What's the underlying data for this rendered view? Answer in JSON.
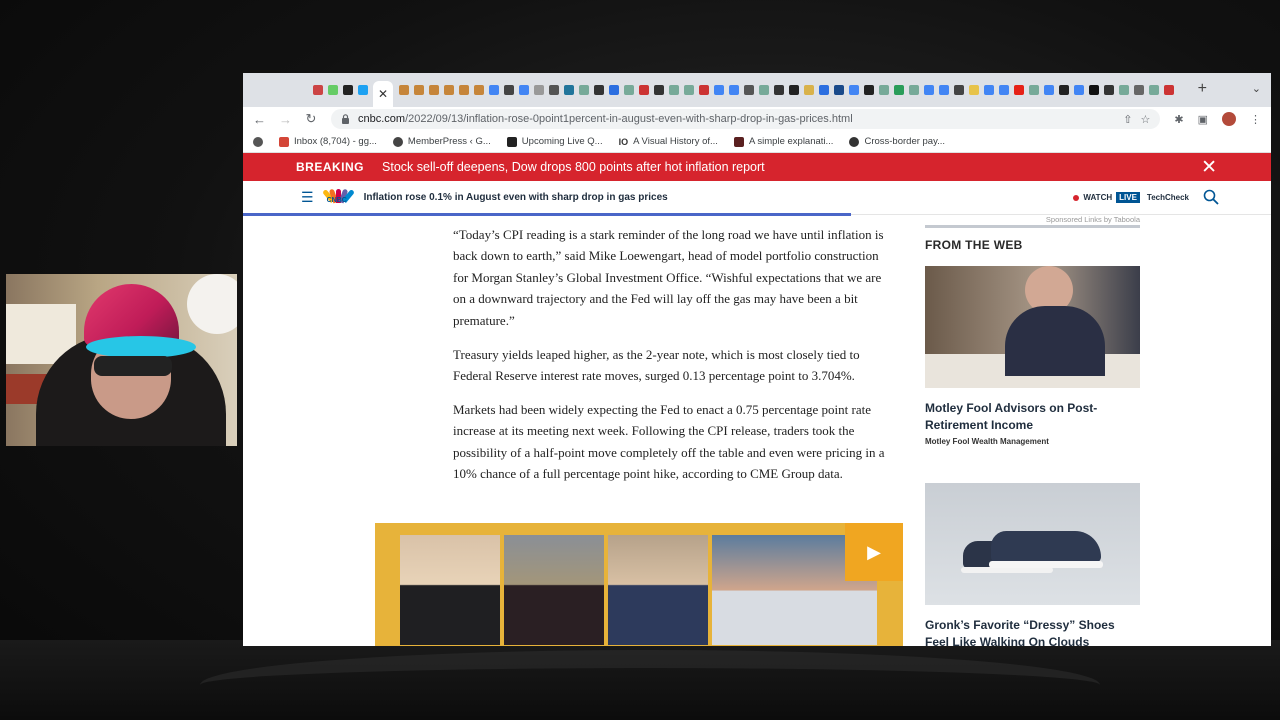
{
  "browser": {
    "active_tab_close": "✕",
    "new_tab": "+",
    "tab_menu": "⌄",
    "nav": {
      "back": "←",
      "forward": "→",
      "reload": "↻"
    },
    "url_host": "cnbc.com",
    "url_path": "/2022/09/13/inflation-rose-0point1percent-in-august-even-with-sharp-drop-in-gas-prices.html",
    "bookmarks": [
      {
        "label": "Inbox (8,704) - gg..."
      },
      {
        "label": "MemberPress ‹ G..."
      },
      {
        "label": "Upcoming Live Q..."
      },
      {
        "label": "A Visual History of..."
      },
      {
        "label": "A simple explanati..."
      },
      {
        "label": "Cross-border pay..."
      }
    ],
    "bookmark_prefixes": [
      "",
      "M",
      "",
      "IO",
      "",
      ""
    ]
  },
  "breaking": {
    "label": "BREAKING",
    "headline": "Stock sell-off deepens, Dow drops 800 points after hot inflation report",
    "close": "✕"
  },
  "cnbc_nav": {
    "logo_text": "CNBC",
    "story_title": "Inflation rose 0.1% in August even with sharp drop in gas prices",
    "watch_label": "WATCH",
    "live_label": "LIVE",
    "techcheck_label": "TechCheck"
  },
  "article": {
    "paragraphs": [
      "“Today’s CPI reading is a stark reminder of the long road we have until inflation is back down to earth,” said Mike Loewengart, head of model portfolio construction for Morgan Stanley’s Global Investment Office. “Wishful expectations that we are on a downward trajectory and the Fed will lay off the gas may have been a bit premature.”",
      "Treasury yields leaped higher, as the 2-year note, which is most closely tied to Federal Reserve interest rate moves, surged 0.13 percentage point to 3.704%.",
      "Markets had been widely expecting the Fed to enact a 0.75 percentage point rate increase at its meeting next week. Following the CPI release, traders took the possibility of a half-point move completely off the table and even were pricing in a 10% chance of a full percentage point hike, according to CME Group data."
    ],
    "video_play": "▶"
  },
  "sidebar": {
    "sponsored": "Sponsored Links by Taboola",
    "heading": "FROM THE WEB",
    "ads": [
      {
        "title": "Motley Fool Advisors on Post-Retirement Income",
        "source": "Motley Fool Wealth Management"
      },
      {
        "title": "Gronk’s Favorite “Dressy” Shoes Feel Like Walking On Clouds",
        "source": ""
      }
    ]
  },
  "colors": {
    "breaking_red": "#d6242d",
    "cnbc_blue": "#005594",
    "progress_blue": "#4a66c8",
    "video_yellow": "#e7b33a"
  }
}
